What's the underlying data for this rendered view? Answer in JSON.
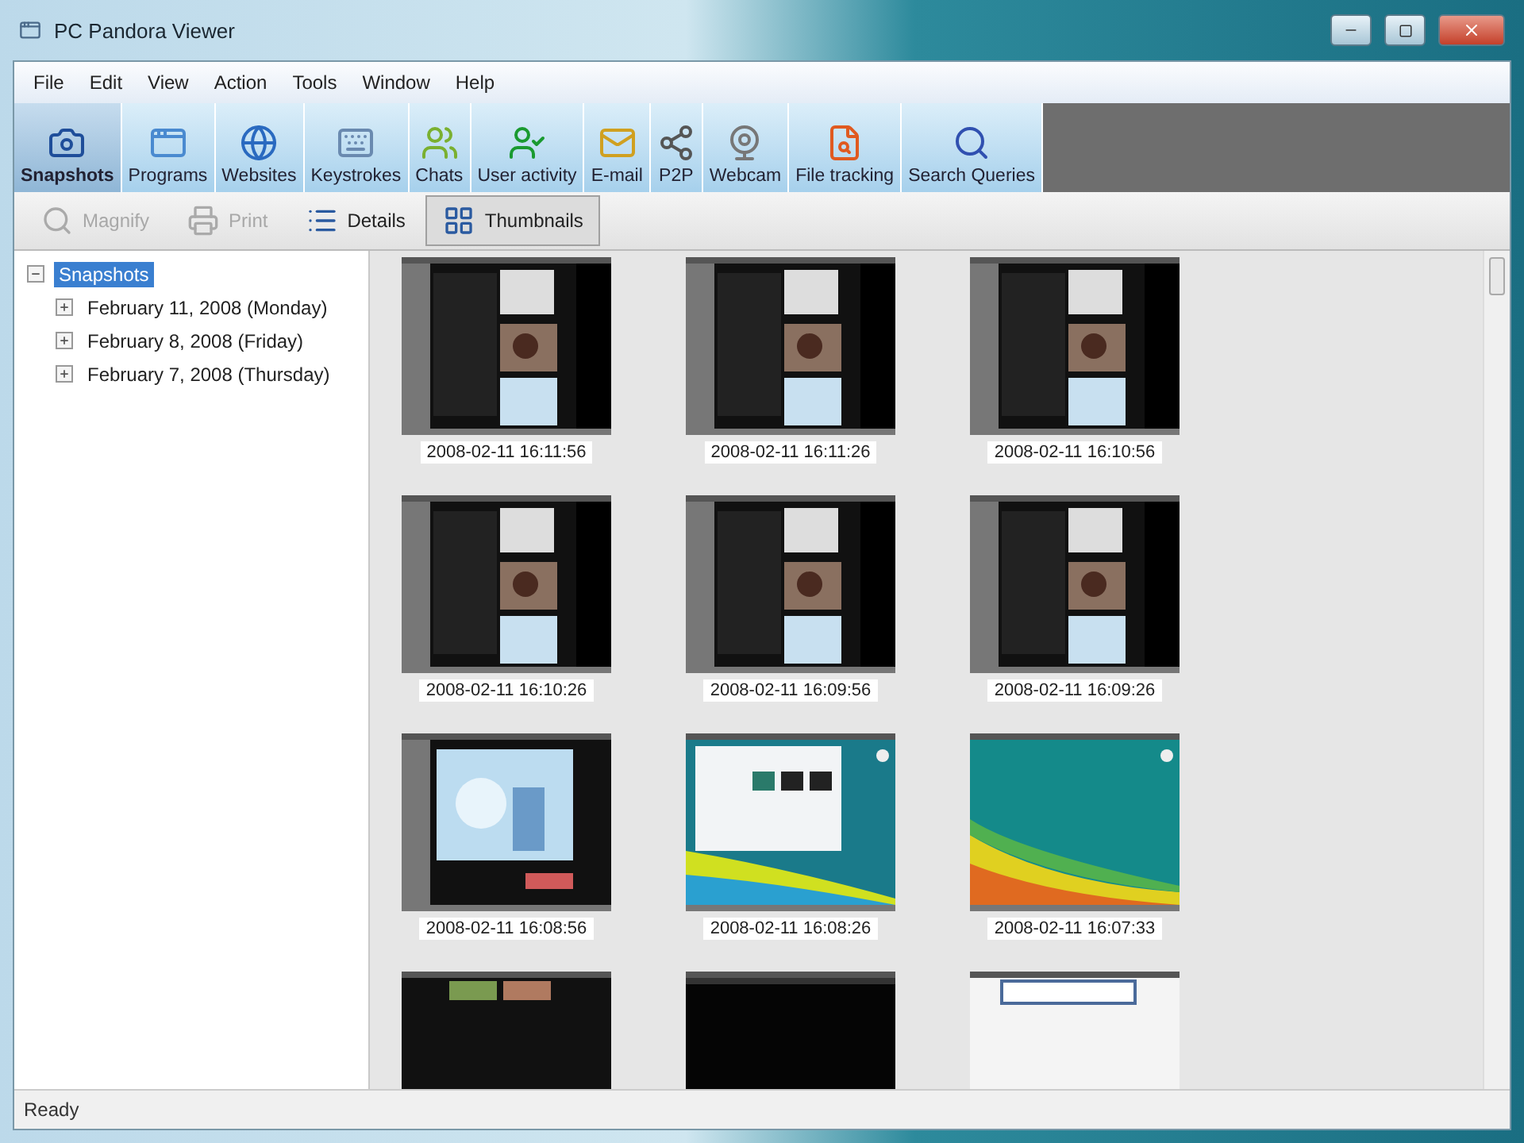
{
  "window": {
    "title": "PC Pandora Viewer"
  },
  "menu": [
    "File",
    "Edit",
    "View",
    "Action",
    "Tools",
    "Window",
    "Help"
  ],
  "toolbar": [
    {
      "label": "Snapshots",
      "selected": true
    },
    {
      "label": "Programs",
      "selected": false
    },
    {
      "label": "Websites",
      "selected": false
    },
    {
      "label": "Keystrokes",
      "selected": false
    },
    {
      "label": "Chats",
      "selected": false
    },
    {
      "label": "User activity",
      "selected": false
    },
    {
      "label": "E-mail",
      "selected": false
    },
    {
      "label": "P2P",
      "selected": false
    },
    {
      "label": "Webcam",
      "selected": false
    },
    {
      "label": "File tracking",
      "selected": false
    },
    {
      "label": "Search Queries",
      "selected": false
    }
  ],
  "view_toolbar": [
    {
      "label": "Magnify",
      "disabled": true,
      "selected": false
    },
    {
      "label": "Print",
      "disabled": true,
      "selected": false
    },
    {
      "label": "Details",
      "disabled": false,
      "selected": false
    },
    {
      "label": "Thumbnails",
      "disabled": false,
      "selected": true
    }
  ],
  "tree": [
    {
      "label": "Snapshots",
      "selected": true,
      "expanded": true,
      "children": [
        {
          "label": "February 11, 2008 (Monday)",
          "selected": false,
          "expanded": false
        },
        {
          "label": "February 8, 2008 (Friday)",
          "selected": false,
          "expanded": false
        },
        {
          "label": "February 7, 2008 (Thursday)",
          "selected": false,
          "expanded": false
        }
      ]
    }
  ],
  "thumbnails": [
    {
      "kind": "picture",
      "caption": "2008-02-11 16:11:56"
    },
    {
      "kind": "picture",
      "caption": "2008-02-11 16:11:26"
    },
    {
      "kind": "picture",
      "caption": "2008-02-11 16:10:56"
    },
    {
      "kind": "picture",
      "caption": "2008-02-11 16:10:26"
    },
    {
      "kind": "picture",
      "caption": "2008-02-11 16:09:56"
    },
    {
      "kind": "picture",
      "caption": "2008-02-11 16:09:26"
    },
    {
      "kind": "picture",
      "caption": "2008-02-11 16:08:56"
    },
    {
      "kind": "picture",
      "caption": "2008-02-11 16:08:26"
    },
    {
      "kind": "picture",
      "caption": "2008-02-11 16:07:33"
    },
    {
      "kind": "picture"
    },
    {
      "kind": "picture"
    },
    {
      "kind": "picture"
    }
  ],
  "status_bar": {
    "text": "Ready"
  }
}
